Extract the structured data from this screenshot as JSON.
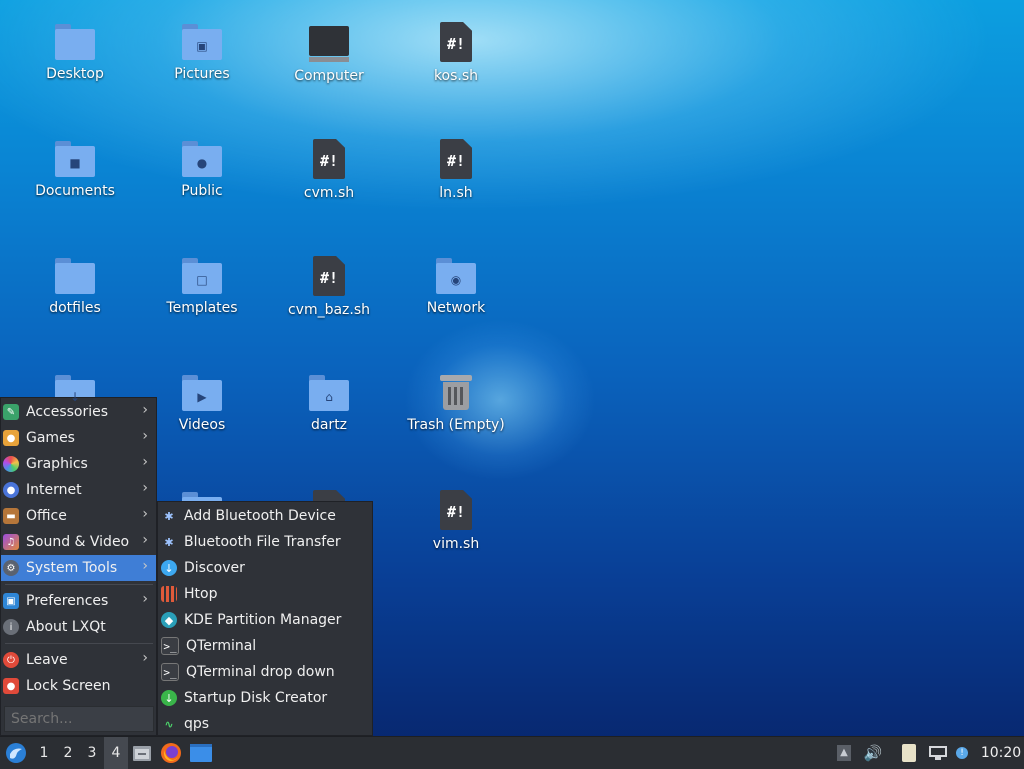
{
  "desktop": {
    "icons": [
      {
        "label": "Desktop"
      },
      {
        "label": "Pictures"
      },
      {
        "label": "Computer"
      },
      {
        "label": "kos.sh"
      },
      {
        "label": "Documents"
      },
      {
        "label": "Public"
      },
      {
        "label": "cvm.sh"
      },
      {
        "label": "ln.sh"
      },
      {
        "label": "dotfiles"
      },
      {
        "label": "Templates"
      },
      {
        "label": "cvm_baz.sh"
      },
      {
        "label": "Network"
      },
      {
        "label": "Videos"
      },
      {
        "label": "dartz"
      },
      {
        "label": "Trash (Empty)"
      },
      {
        "label": "vim.sh"
      }
    ],
    "script_glyph": "#!"
  },
  "menu": {
    "items": [
      {
        "label": "Accessories",
        "icon": "accessories-icon"
      },
      {
        "label": "Games",
        "icon": "games-icon"
      },
      {
        "label": "Graphics",
        "icon": "graphics-icon"
      },
      {
        "label": "Internet",
        "icon": "internet-icon"
      },
      {
        "label": "Office",
        "icon": "office-icon"
      },
      {
        "label": "Sound & Video",
        "icon": "sound-video-icon"
      },
      {
        "label": "System Tools",
        "icon": "system-tools-icon"
      },
      {
        "label": "Preferences",
        "icon": "preferences-icon"
      },
      {
        "label": "About LXQt",
        "icon": "info-icon"
      },
      {
        "label": "Leave",
        "icon": "power-icon"
      },
      {
        "label": "Lock Screen",
        "icon": "lock-icon"
      }
    ],
    "search_placeholder": "Search...",
    "selected": "System Tools"
  },
  "submenu": {
    "items": [
      {
        "label": "Add Bluetooth Device",
        "icon": "bluetooth-icon"
      },
      {
        "label": "Bluetooth File Transfer",
        "icon": "bluetooth-icon"
      },
      {
        "label": "Discover",
        "icon": "discover-icon"
      },
      {
        "label": "Htop",
        "icon": "htop-icon"
      },
      {
        "label": "KDE Partition Manager",
        "icon": "partition-manager-icon"
      },
      {
        "label": "QTerminal",
        "icon": "terminal-icon"
      },
      {
        "label": "QTerminal drop down",
        "icon": "terminal-icon"
      },
      {
        "label": "Startup Disk Creator",
        "icon": "startup-disk-icon"
      },
      {
        "label": "qps",
        "icon": "qps-icon"
      }
    ]
  },
  "taskbar": {
    "workspaces": [
      "1",
      "2",
      "3",
      "4"
    ],
    "active_workspace": "4",
    "clock": "10:20"
  },
  "colors": {
    "menu_bg": "#2f3238",
    "selected": "#3f7ed6",
    "taskbar_bg": "#2b2e33"
  }
}
